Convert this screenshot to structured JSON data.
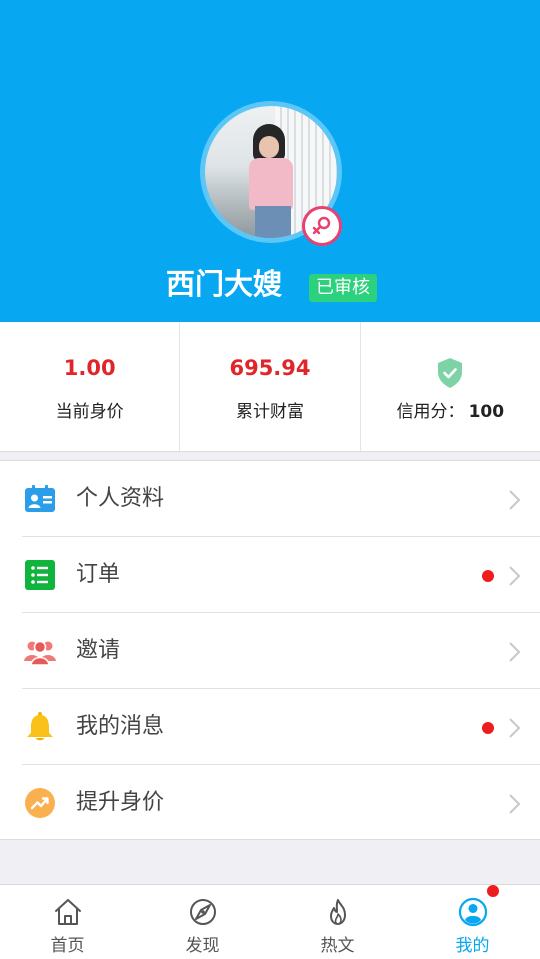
{
  "profile": {
    "name": "西门大嫂",
    "verified_label": "已审核",
    "gender": "female"
  },
  "stats": {
    "worth": {
      "value": "1.00",
      "label": "当前身价"
    },
    "wealth": {
      "value": "695.94",
      "label": "累计财富"
    },
    "credit": {
      "label": "信用分：",
      "value": "100"
    }
  },
  "menu": {
    "items": [
      {
        "label": "个人资料",
        "icon": "profile-card-icon",
        "dot": false
      },
      {
        "label": "订单",
        "icon": "order-list-icon",
        "dot": true
      },
      {
        "label": "邀请",
        "icon": "invite-people-icon",
        "dot": false
      },
      {
        "label": "我的消息",
        "icon": "bell-icon",
        "dot": true
      },
      {
        "label": "提升身价",
        "icon": "trend-up-icon",
        "dot": false
      }
    ]
  },
  "tabbar": {
    "tabs": [
      {
        "label": "首页",
        "icon": "home-icon",
        "active": false
      },
      {
        "label": "发现",
        "icon": "discover-icon",
        "active": false
      },
      {
        "label": "热文",
        "icon": "fire-icon",
        "active": false
      },
      {
        "label": "我的",
        "icon": "user-icon",
        "active": true
      }
    ]
  },
  "colors": {
    "header_bg": "#07a7f2",
    "accent_red": "#e0262b",
    "verified_green": "#2bd17c",
    "active_tab": "#07a7f2"
  }
}
